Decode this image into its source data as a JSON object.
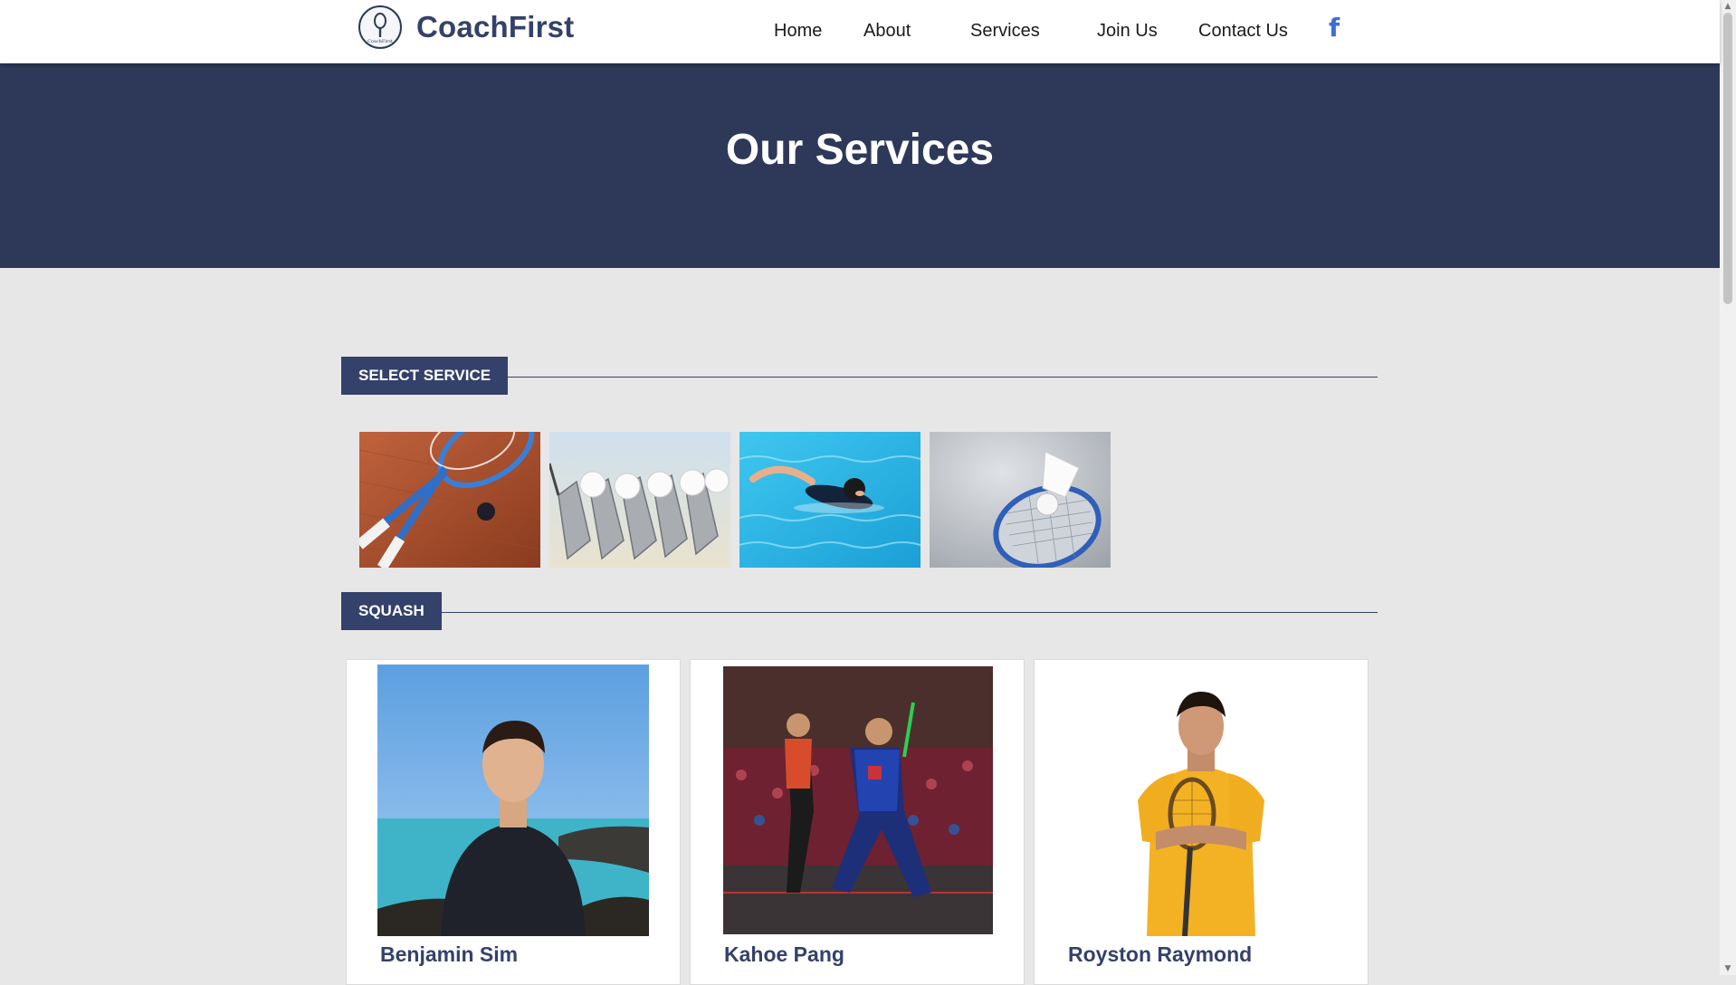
{
  "brand": {
    "name": "CoachFirst",
    "logo_icon": "racket-logo-icon"
  },
  "nav": {
    "items": [
      {
        "label": "Home"
      },
      {
        "label": "About"
      },
      {
        "label": "Services"
      },
      {
        "label": "Join Us"
      },
      {
        "label": "Contact Us"
      }
    ],
    "social_icon": "facebook-icon",
    "social_glyph": "f"
  },
  "hero": {
    "title": "Our Services"
  },
  "select_service": {
    "label": "SELECT SERVICE",
    "services": [
      {
        "name": "squash",
        "icon": "squash-rackets-image"
      },
      {
        "name": "golf",
        "icon": "golf-clubs-image"
      },
      {
        "name": "swimming",
        "icon": "swimmer-image"
      },
      {
        "name": "badminton",
        "icon": "shuttlecock-image"
      }
    ]
  },
  "squash_section": {
    "label": "SQUASH",
    "coaches": [
      {
        "name": "Benjamin Sim"
      },
      {
        "name": "Kahoe Pang"
      },
      {
        "name": "Royston Raymond"
      }
    ]
  },
  "colors": {
    "primary": "#34416a",
    "hero_bg": "#2e3959",
    "page_bg": "#e7e7e7",
    "facebook": "#3b6fd4"
  }
}
